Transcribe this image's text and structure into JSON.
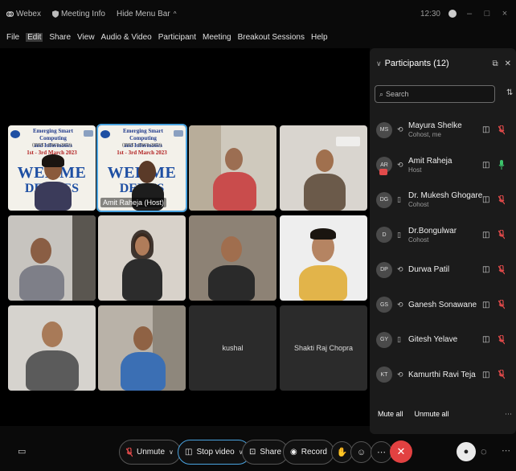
{
  "titlebar": {
    "app_name": "Webex",
    "meeting_info": "Meeting Info",
    "hide_menu_bar": "Hide Menu Bar",
    "time": "12:30"
  },
  "menu": [
    "File",
    "Edit",
    "Share",
    "View",
    "Audio & Video",
    "Participant",
    "Meeting",
    "Breakout Sessions",
    "Help"
  ],
  "banner": {
    "title_line1": "Emerging Smart Computing",
    "title_line2": "and Informatics",
    "conference": "(IEEE - ESCI-2023)",
    "dates_tile1": "1st - 3rd March 2023",
    "dates_tile2": "1st - 3rd March 2023",
    "welcome_tile1": "WEL   ME",
    "welcome_tile2": "WEL   ME",
    "delegates_tile1": "DELE   ES",
    "delegates_tile2": "DEL   ES"
  },
  "tiles": {
    "host_label": "Amit Raheja (Host)",
    "kushal": "kushal",
    "shakti": "Shakti Raj Chopra"
  },
  "panel": {
    "title": "Participants (12)",
    "search_placeholder": "Search",
    "participants": [
      {
        "initials": "MS",
        "name": "Mayura Shelke",
        "role": "Cohost, me",
        "device": "audio",
        "mic": "muted"
      },
      {
        "initials": "AR",
        "name": "Amit Raheja",
        "role": "Host",
        "device": "audio",
        "mic": "active"
      },
      {
        "initials": "DG",
        "name": "Dr. Mukesh Ghogare",
        "role": "Cohost",
        "device": "phone",
        "mic": "muted"
      },
      {
        "initials": "D",
        "name": "Dr.Bongulwar",
        "role": "Cohost",
        "device": "phone",
        "mic": "muted"
      },
      {
        "initials": "DP",
        "name": "Durwa Patil",
        "role": "",
        "device": "audio",
        "mic": "muted"
      },
      {
        "initials": "GS",
        "name": "Ganesh Sonawane",
        "role": "",
        "device": "audio",
        "mic": "muted"
      },
      {
        "initials": "GY",
        "name": "Gitesh Yelave",
        "role": "",
        "device": "phone",
        "mic": "muted"
      },
      {
        "initials": "KT",
        "name": "Kamurthi Ravi Teja",
        "role": "",
        "device": "audio",
        "mic": "muted"
      }
    ],
    "mute_all": "Mute all",
    "unmute_all": "Unmute all"
  },
  "controls": {
    "unmute": "Unmute",
    "stop_video": "Stop video",
    "share": "Share",
    "record": "Record"
  },
  "colors": {
    "accent": "#4aa3df",
    "end_call": "#e24141",
    "muted": "#e24a4a",
    "speaking": "#3cc46b"
  }
}
